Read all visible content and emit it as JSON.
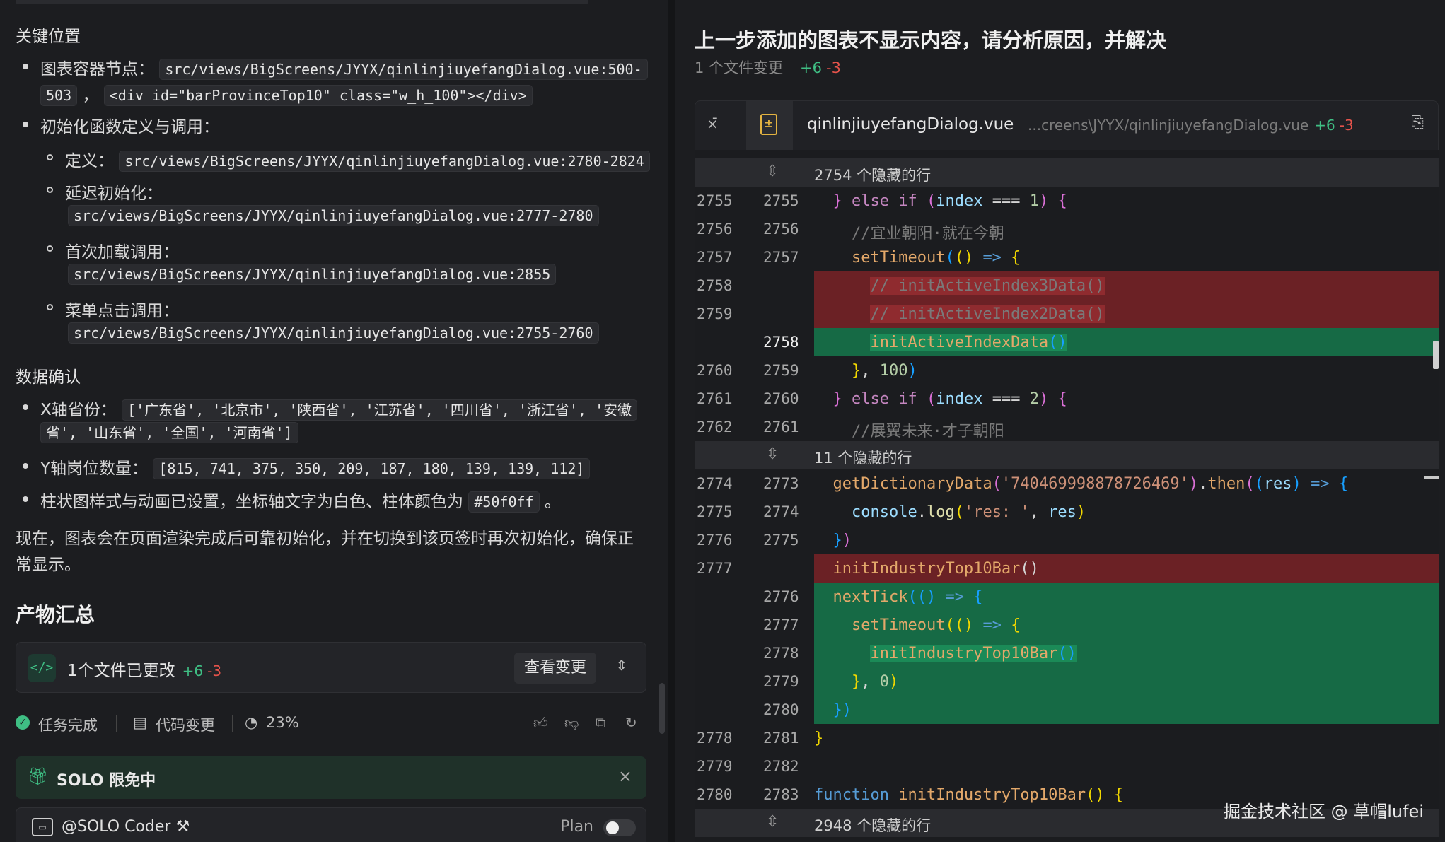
{
  "left": {
    "key_positions_heading": "关键位置",
    "items": [
      {
        "label": "图表容器节点：",
        "code1": "src/views/BigScreens/JYYX/qinlinjiuyefangDialog.vue:500-",
        "code1b": "503",
        "sep": "，",
        "code2": "<div id=\"barProvinceTop10\" class=\"w_h_100\"></div>"
      },
      {
        "label": "初始化函数定义与调用："
      }
    ],
    "sub_items": [
      {
        "label": "定义：",
        "code": "src/views/BigScreens/JYYX/qinlinjiuyefangDialog.vue:2780-2824"
      },
      {
        "label": "延迟初始化：",
        "code": "src/views/BigScreens/JYYX/qinlinjiuyefangDialog.vue:2777-2780"
      },
      {
        "label": "首次加载调用：",
        "code": "src/views/BigScreens/JYYX/qinlinjiuyefangDialog.vue:2855"
      },
      {
        "label": "菜单点击调用：",
        "code": "src/views/BigScreens/JYYX/qinlinjiuyefangDialog.vue:2755-2760"
      }
    ],
    "data_heading": "数据确认",
    "data_items": [
      {
        "label": "X轴省份：",
        "code": "['广东省', '北京市', '陕西省', '江苏省', '四川省', '浙江省', '安徽",
        "code_b": "省', '山东省', '全国', '河南省']"
      },
      {
        "label": "Y轴岗位数量：",
        "code": "[815, 741, 375, 350, 209, 187, 180, 139, 139, 112]"
      },
      {
        "label": "柱状图样式与动画已设置，坐标轴文字为白色、柱体颜色为",
        "code": "#50f0ff",
        "tail": "。"
      }
    ],
    "paragraph_line1": "现在，图表会在页面渲染完成后可靠初始化，并在切换到该页签时再次初始化，确保正",
    "paragraph_line2": "常显示。",
    "summary_heading": "产物汇总",
    "file_card": {
      "label": "1个文件已更改",
      "added": "+6",
      "removed": "-3",
      "button": "查看变更"
    },
    "status": {
      "done": "任务完成",
      "code_change": "代码变更",
      "percent": "23%"
    },
    "solo_banner": "SOLO 限免中",
    "coder": {
      "label": "@SOLO Coder",
      "mode": "Plan"
    }
  },
  "right": {
    "title": "上一步添加的图表不显示内容，请分析原因，并解决",
    "summary": "1 个文件变更",
    "added": "+6",
    "removed": "-3",
    "file": {
      "name": "qinlinjiuyefangDialog.vue",
      "path": "...creens\\JYYX/qinlinjiuyefangDialog.vue",
      "added": "+6",
      "removed": "-3"
    },
    "hidden_1": "2754 个隐藏的行",
    "hidden_2": "11 个隐藏的行",
    "hidden_3": "2948 个隐藏的行",
    "lines": [
      {
        "o": "2755",
        "n": "2755"
      },
      {
        "o": "2756",
        "n": "2756"
      },
      {
        "o": "2757",
        "n": "2757"
      },
      {
        "o": "2758",
        "n": ""
      },
      {
        "o": "2759",
        "n": ""
      },
      {
        "o": "",
        "n": "2758"
      },
      {
        "o": "2760",
        "n": "2759"
      },
      {
        "o": "2761",
        "n": "2760"
      },
      {
        "o": "2762",
        "n": "2761"
      },
      {
        "o": "2774",
        "n": "2773"
      },
      {
        "o": "2775",
        "n": "2774"
      },
      {
        "o": "2776",
        "n": "2775"
      },
      {
        "o": "2777",
        "n": ""
      },
      {
        "o": "",
        "n": "2776"
      },
      {
        "o": "",
        "n": "2777"
      },
      {
        "o": "",
        "n": "2778"
      },
      {
        "o": "",
        "n": "2779"
      },
      {
        "o": "",
        "n": "2780"
      },
      {
        "o": "2778",
        "n": "2781"
      },
      {
        "o": "2779",
        "n": "2782"
      },
      {
        "o": "2780",
        "n": "2783"
      }
    ],
    "code": {
      "c1": "//宜业朝阳·就在今朝",
      "c2": "// initActiveIndex3Data()",
      "c3": "// initActiveIndex2Data()",
      "c4": "//展翼未来·才子朝阳",
      "dict_id": "'7404699988787264​69'",
      "log_str": "'res: '"
    }
  },
  "watermark": "掘金技术社区 @ 草帽lufei"
}
